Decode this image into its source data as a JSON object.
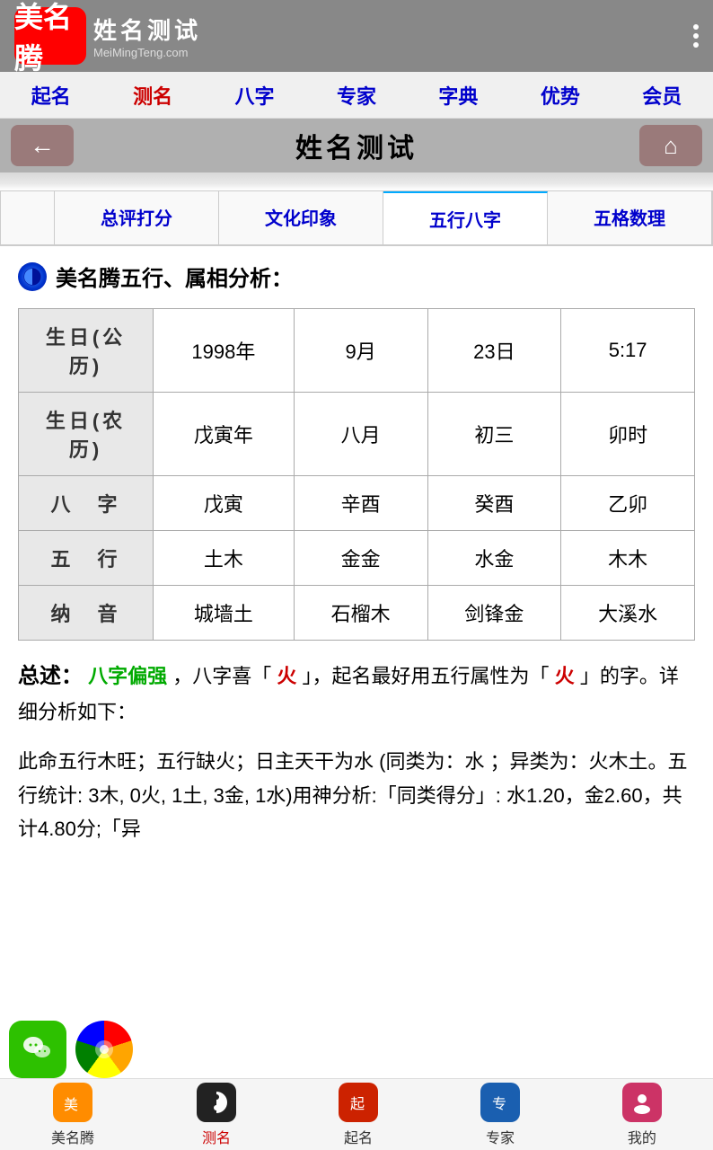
{
  "header": {
    "logo_cn": "美名腾",
    "logo_text": "美名腾",
    "title_cn": "姓名测试",
    "title_pinyin": "MeiMingTeng.com"
  },
  "nav": {
    "items": [
      {
        "label": "起名",
        "active": false
      },
      {
        "label": "测名",
        "active": true
      },
      {
        "label": "八字",
        "active": false
      },
      {
        "label": "专家",
        "active": false
      },
      {
        "label": "字典",
        "active": false
      },
      {
        "label": "优势",
        "active": false
      },
      {
        "label": "会员",
        "active": false
      }
    ]
  },
  "toolbar": {
    "title": "姓名测试",
    "back_label": "←",
    "home_label": "🏠"
  },
  "tabs": [
    {
      "label": "总评打分",
      "active": false
    },
    {
      "label": "文化印象",
      "active": false
    },
    {
      "label": "五行八字",
      "active": true
    },
    {
      "label": "五格数理",
      "active": false
    }
  ],
  "section": {
    "title": "美名腾五行、属相分析："
  },
  "birthday_solar": {
    "label": "生日(公历)",
    "year": "1998年",
    "month": "9月",
    "day": "23日",
    "time": "5:17"
  },
  "birthday_lunar": {
    "label": "生日(农历)",
    "year": "戊寅年",
    "month": "八月",
    "day": "初三",
    "time": "卯时"
  },
  "bazi": {
    "label": "八　字",
    "col1": "戊寅",
    "col2": "辛酉",
    "col3": "癸酉",
    "col4": "乙卯"
  },
  "wuxing": {
    "label": "五　行",
    "col1": "土木",
    "col2": "金金",
    "col3": "水金",
    "col4": "木木"
  },
  "nayin": {
    "label": "纳　音",
    "col1": "城墙土",
    "col2": "石榴木",
    "col3": "剑锋金",
    "col4": "大溪水"
  },
  "summary": {
    "label": "总述：",
    "text_part1": "八字偏强",
    "text_part2": "，八字喜「",
    "fire_char": "火",
    "text_part3": "」，起名最好用五行属性为「",
    "fire_char2": "火",
    "text_part4": "」的字。详细分析如下："
  },
  "detail": {
    "text": "此命五行木旺；五行缺火；日主天干为水 (同类为：水 ；异类为：火木土。五行统计: 3木, 0火, 1土, 3金, 1水)用神分析:「同类得分」: 水1.20，金2.60，共计4.80分;「异"
  },
  "bottom_nav": {
    "items": [
      {
        "label": "美名腾",
        "active": false,
        "icon": "logo"
      },
      {
        "label": "测名",
        "active": true,
        "icon": "yin-yang"
      },
      {
        "label": "起名",
        "active": false,
        "icon": "brush"
      },
      {
        "label": "专家",
        "active": false,
        "icon": "expert"
      },
      {
        "label": "我的",
        "active": false,
        "icon": "person"
      }
    ]
  }
}
